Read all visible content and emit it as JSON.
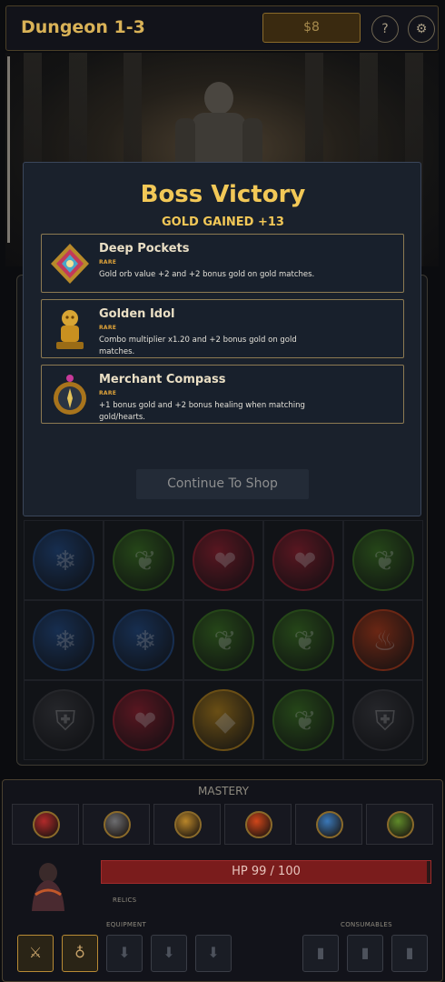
{
  "header": {
    "title": "Dungeon 1-3",
    "gold": "$8",
    "help": "?",
    "settings": "⚙"
  },
  "board": {
    "rows": [
      [
        {
          "type": "ice",
          "icon": "❄",
          "color": "#1d4a8a"
        },
        {
          "type": "leaf",
          "icon": "❦",
          "color": "#3a7a1a"
        },
        {
          "type": "heart",
          "icon": "❤",
          "color": "#a01a2a"
        },
        {
          "type": "heart",
          "icon": "❤",
          "color": "#a01a2a"
        },
        {
          "type": "leaf",
          "icon": "❦",
          "color": "#3a7a1a"
        }
      ],
      [
        {
          "type": "ice",
          "icon": "❄",
          "color": "#1d4a8a"
        },
        {
          "type": "ice",
          "icon": "❄",
          "color": "#1d4a8a"
        },
        {
          "type": "leaf",
          "icon": "❦",
          "color": "#3a7a1a"
        },
        {
          "type": "leaf",
          "icon": "❦",
          "color": "#3a7a1a"
        },
        {
          "type": "fire",
          "icon": "♨",
          "color": "#c23a12"
        }
      ],
      [
        {
          "type": "shield",
          "icon": "⛨",
          "color": "#3a3a3e"
        },
        {
          "type": "heart",
          "icon": "❤",
          "color": "#a01a2a"
        },
        {
          "type": "gold",
          "icon": "◆",
          "color": "#c28a14"
        },
        {
          "type": "leaf",
          "icon": "❦",
          "color": "#3a7a1a"
        },
        {
          "type": "shield",
          "icon": "⛨",
          "color": "#3a3a3e"
        }
      ]
    ]
  },
  "modal": {
    "title": "Boss Victory",
    "subtitle": "GOLD GAINED +13",
    "rewards": [
      {
        "name": "Deep Pockets",
        "rarity": "RARE",
        "description": "Gold orb value +2 and +2 bonus gold on gold matches.",
        "icon": "star-gem-icon"
      },
      {
        "name": "Golden Idol",
        "rarity": "RARE",
        "description": "Combo multiplier x1.20 and +2 bonus gold on gold matches.",
        "icon": "idol-icon"
      },
      {
        "name": "Merchant Compass",
        "rarity": "RARE",
        "description": "+1 bonus gold and +2 bonus healing when matching gold/hearts.",
        "icon": "compass-icon"
      }
    ],
    "continue_label": "Continue To Shop"
  },
  "bottom": {
    "mastery_label": "MASTERY",
    "mastery": [
      {
        "name": "heart",
        "color": "#b12a2a"
      },
      {
        "name": "shield",
        "color": "#6d6d70"
      },
      {
        "name": "gold",
        "color": "#b9862a"
      },
      {
        "name": "fire",
        "color": "#d0461a"
      },
      {
        "name": "ice",
        "color": "#3a78b8"
      },
      {
        "name": "leaf",
        "color": "#5f8a2a"
      }
    ],
    "hp_text": "HP 99 / 100",
    "hp_fraction": 0.99,
    "relics_label": "RELICS",
    "equipment_label": "EQUIPMENT",
    "consumables_label": "CONSUMABLES"
  }
}
